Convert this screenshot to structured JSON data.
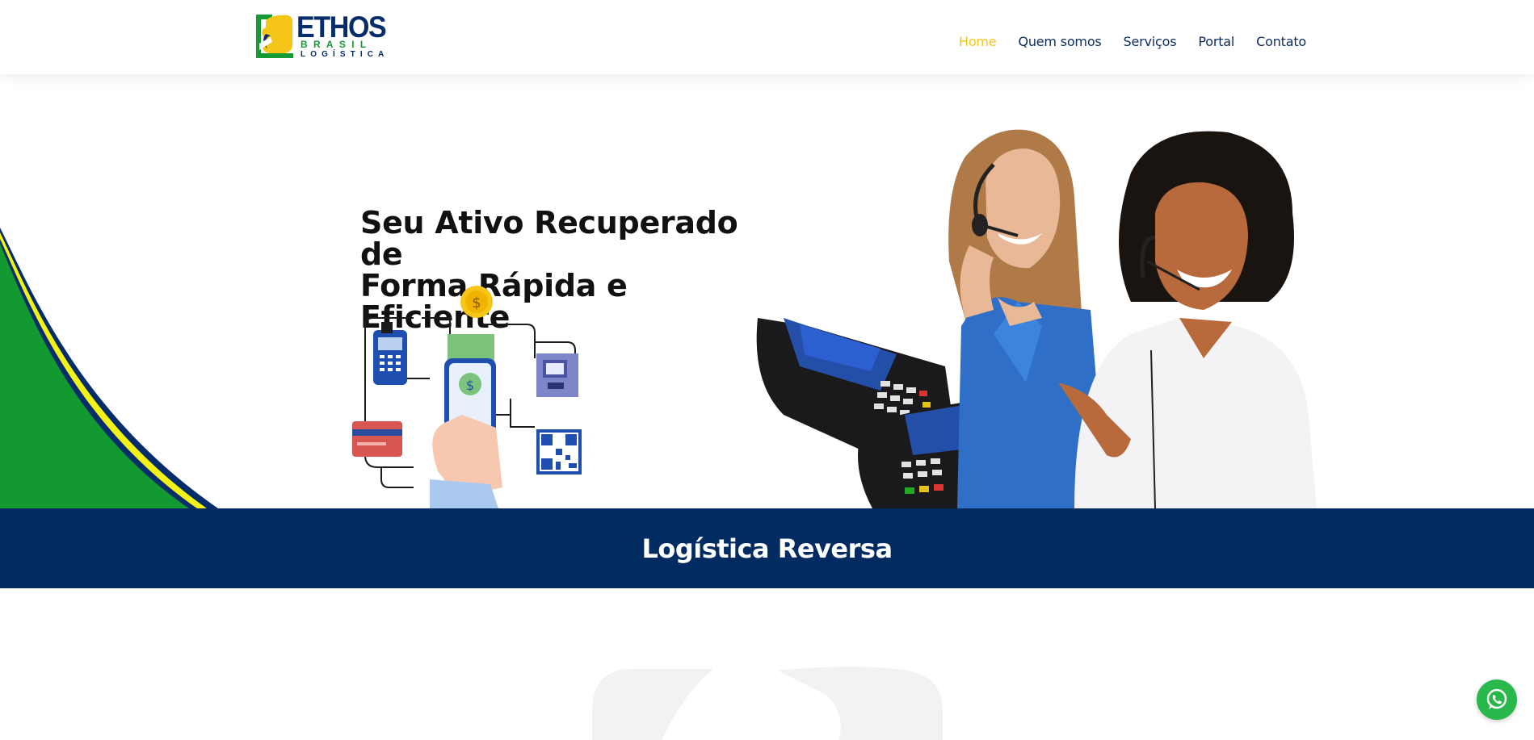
{
  "brand": {
    "name": "ETHOS",
    "line1": "BRASIL",
    "line2": "LOGÍSTICA",
    "colors": {
      "navy": "#062d6b",
      "green": "#159a36",
      "yellow": "#f5c518"
    }
  },
  "nav": {
    "items": [
      {
        "label": "Home",
        "active": true
      },
      {
        "label": "Quem somos",
        "active": false
      },
      {
        "label": "Serviços",
        "active": false
      },
      {
        "label": "Portal",
        "active": false
      },
      {
        "label": "Contato",
        "active": false
      }
    ]
  },
  "hero": {
    "title_line1": "Seu Ativo Recuperado de",
    "title_line2": "Forma Rápida e Eficiente"
  },
  "banner": {
    "title": "Logística Reversa"
  },
  "whatsapp": {
    "icon": "whatsapp-icon"
  }
}
